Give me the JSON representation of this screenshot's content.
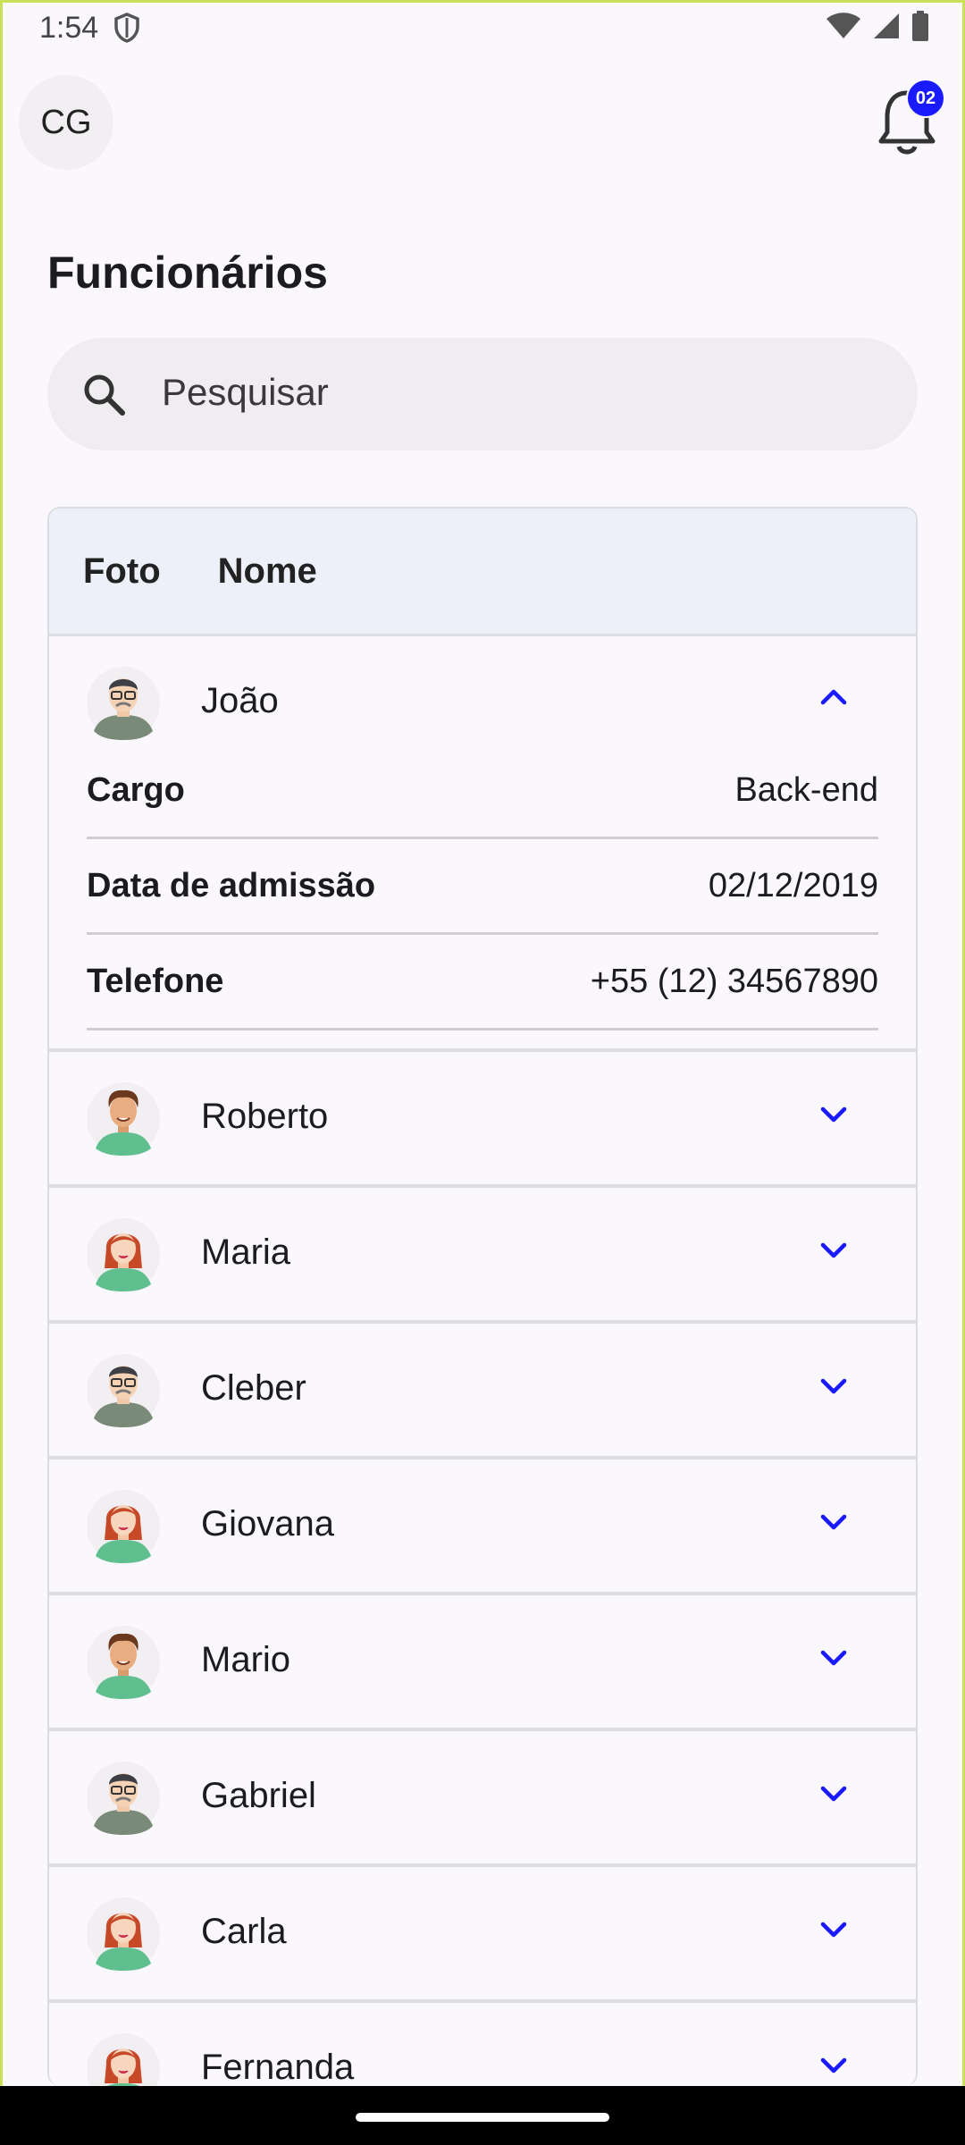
{
  "status_bar": {
    "time": "1:54"
  },
  "header": {
    "avatar_initials": "CG",
    "notification_count": "02"
  },
  "page": {
    "title": "Funcionários"
  },
  "search": {
    "placeholder": "Pesquisar"
  },
  "table": {
    "columns": [
      "Foto",
      "Nome"
    ],
    "rows": [
      {
        "name": "João",
        "avatar": "man-glasses-avatar",
        "expanded": true,
        "details": [
          {
            "label": "Cargo",
            "value": "Back-end"
          },
          {
            "label": "Data de admissão",
            "value": "02/12/2019"
          },
          {
            "label": "Telefone",
            "value": "+55 (12) 34567890"
          }
        ]
      },
      {
        "name": "Roberto",
        "avatar": "man-curly-avatar",
        "expanded": false
      },
      {
        "name": "Maria",
        "avatar": "woman-redhead-avatar",
        "expanded": false
      },
      {
        "name": "Cleber",
        "avatar": "man-glasses-avatar",
        "expanded": false
      },
      {
        "name": "Giovana",
        "avatar": "woman-redhead-avatar",
        "expanded": false
      },
      {
        "name": "Mario",
        "avatar": "man-curly-avatar",
        "expanded": false
      },
      {
        "name": "Gabriel",
        "avatar": "man-glasses-avatar",
        "expanded": false
      },
      {
        "name": "Carla",
        "avatar": "woman-redhead-avatar",
        "expanded": false
      },
      {
        "name": "Fernanda",
        "avatar": "woman-redhead-avatar",
        "expanded": false
      }
    ]
  },
  "colors": {
    "accent": "#1a1aff",
    "header_bg": "#edf0f8",
    "background": "#fbf8fd"
  }
}
